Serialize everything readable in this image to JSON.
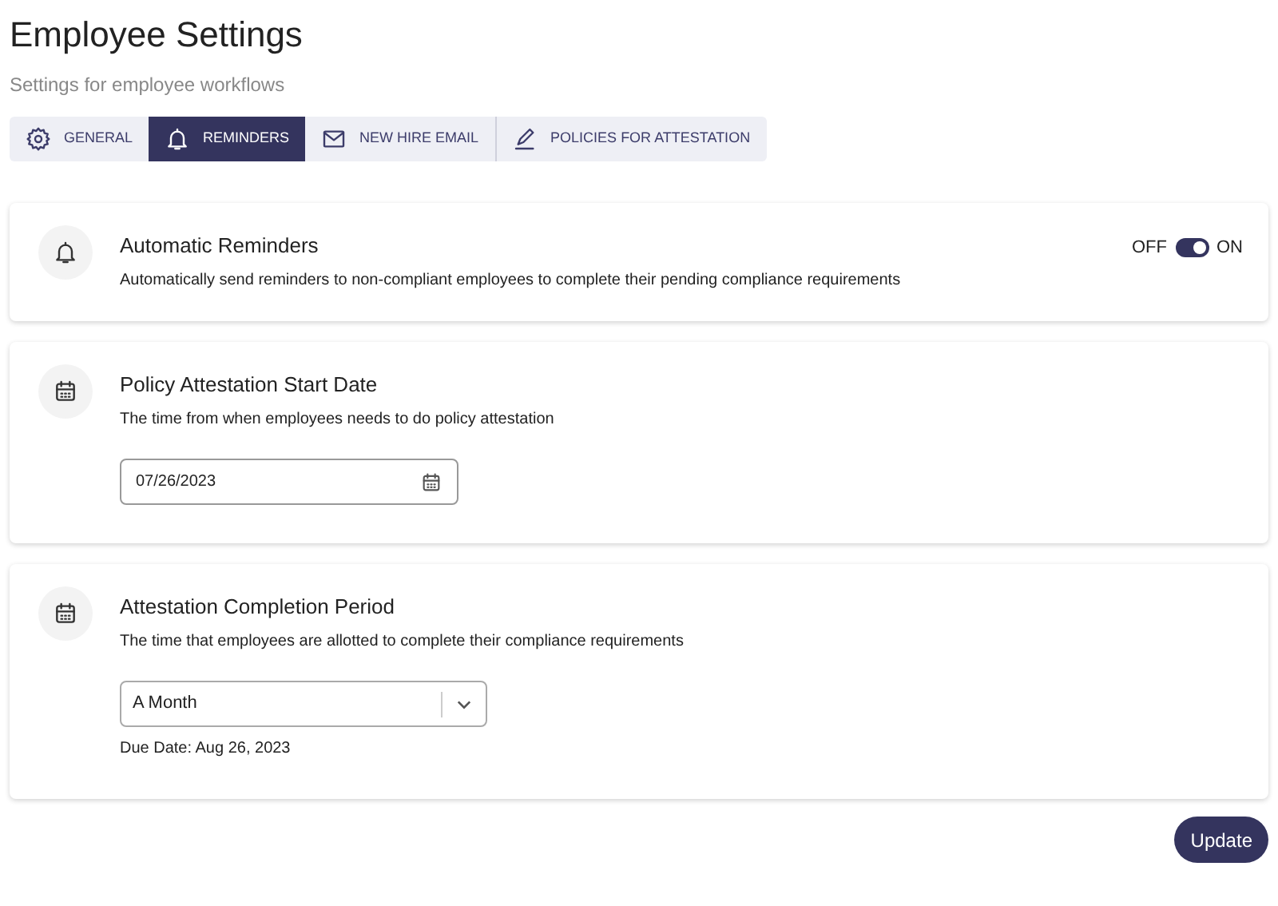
{
  "header": {
    "title": "Employee Settings",
    "subtitle": "Settings for employee workflows"
  },
  "tabs": [
    {
      "label": "GENERAL",
      "selected": false
    },
    {
      "label": "REMINDERS",
      "selected": true
    },
    {
      "label": "NEW HIRE EMAIL",
      "selected": false
    },
    {
      "label": "POLICIES FOR ATTESTATION",
      "selected": false
    }
  ],
  "sections": [
    {
      "kind": "toggle",
      "title": "Automatic Reminders",
      "description": "Automatically send reminders to non-compliant employees to complete their pending compliance requirements",
      "off_label": "OFF",
      "on_label": "ON",
      "on": true
    },
    {
      "kind": "date",
      "title": "Policy Attestation Start Date",
      "description": "The time from when employees needs to do policy attestation",
      "value": "07/26/2023"
    },
    {
      "kind": "select",
      "title": "Attestation Completion Period",
      "description": "The time that employees are allotted to complete their compliance requirements",
      "value": "A Month",
      "note": "Due Date: Aug 26, 2023"
    }
  ],
  "update_button": "Update"
}
